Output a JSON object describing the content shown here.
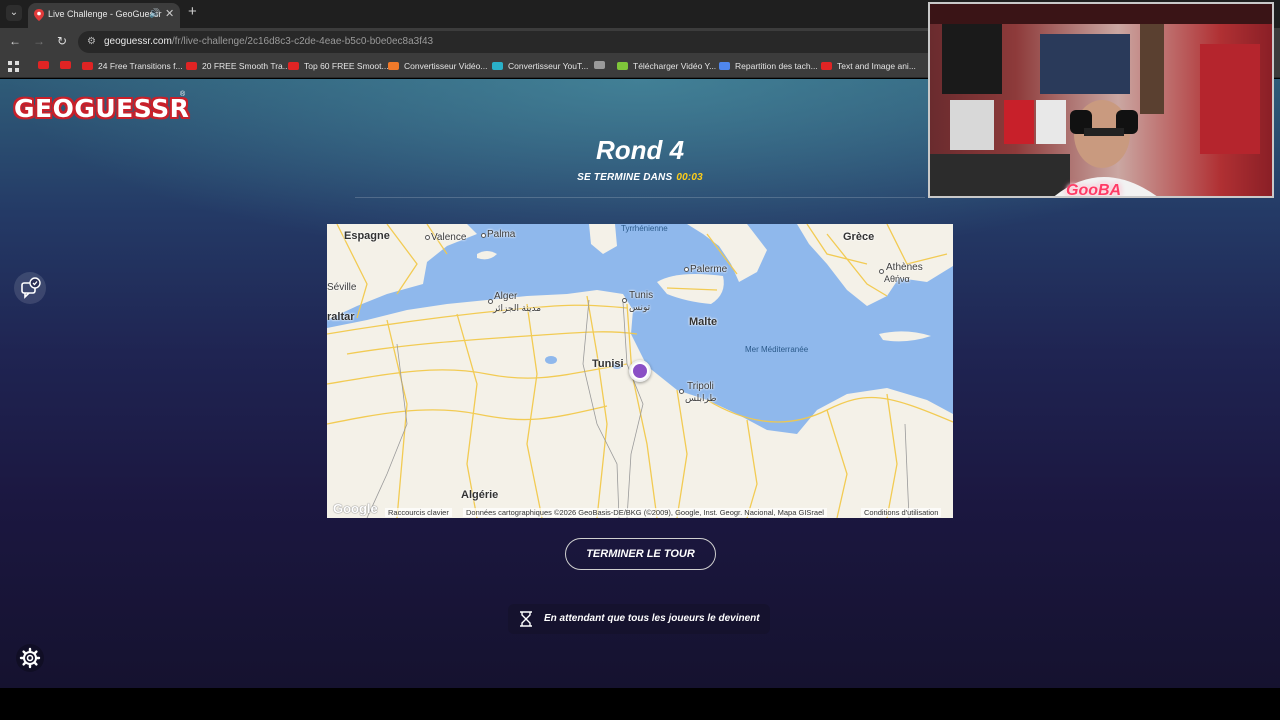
{
  "browser": {
    "tab_title": "Live Challenge - GeoGuessr",
    "url_host": "geoguessr.com",
    "url_path": "/fr/live-challenge/2c16d8c3-c2de-4eae-b5c0-b0e0ec8a3f43",
    "bookmarks": [
      {
        "label": "",
        "color": "#e02424"
      },
      {
        "label": "",
        "color": "#e02424"
      },
      {
        "label": "24 Free Transitions f...",
        "color": "#e02424"
      },
      {
        "label": "20 FREE Smooth Tra...",
        "color": "#e02424"
      },
      {
        "label": "Top 60 FREE Smoot...",
        "color": "#e02424"
      },
      {
        "label": "Convertisseur Vidéo...",
        "color": "#f07a2a"
      },
      {
        "label": "Convertisseur YouT...",
        "color": "#2ab0c8"
      },
      {
        "label": "",
        "color": "#9a9a9a"
      },
      {
        "label": "Télécharger Vidéo Y...",
        "color": "#7fc63a"
      },
      {
        "label": "Repartition des tach...",
        "color": "#4f86ec"
      },
      {
        "label": "Text and Image ani...",
        "color": "#e02424"
      }
    ]
  },
  "header": {
    "logo": "GEOGUESSR",
    "round_title": "Rond 4",
    "ends_in_label": "SE TERMINE DANS",
    "timer": "00:03"
  },
  "map": {
    "labels": {
      "espagne": "Espagne",
      "valence": "Valence",
      "palma": "Palma",
      "tyrrhenienne": "Tyrrhénienne",
      "grece": "Grèce",
      "seville": "Séville",
      "palerme": "Palerme",
      "athenes": "Athènes",
      "athenes_gr": "Αθήνα",
      "gibraltar": "raltar",
      "alger": "Alger",
      "alger_ar": "مدينة الجزائر",
      "tunis": "Tunis",
      "tunis_ar": "تونس",
      "malte": "Malte",
      "mer_med": "Mer Méditerranée",
      "tunisie": "Tunisi",
      "tripoli": "Tripoli",
      "tripoli_ar": "طرابلس",
      "algerie": "Algérie"
    },
    "google": "Google",
    "shortcuts": "Raccourcis clavier",
    "data_credit": "Données cartographiques ©2026 GeoBasis-DE/BKG (©2009), Google, Inst. Geogr. Nacional, Mapa GISrael",
    "terms": "Conditions d'utilisation"
  },
  "actions": {
    "end_round": "TERMINER LE TOUR",
    "waiting": "En attendant que tous les joueurs le devinent"
  },
  "webcam": {
    "nickname": "GooBA"
  },
  "colors": {
    "timer": "#fecd19",
    "logo_red": "#c8202a",
    "sea": "#8fb8ec",
    "land": "#f4f1e8",
    "road": "#f2c94c"
  }
}
